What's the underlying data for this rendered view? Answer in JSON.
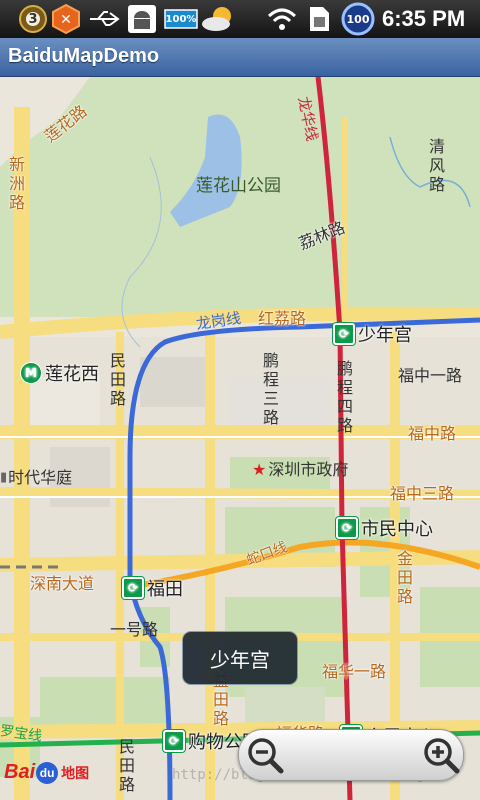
{
  "status_bar": {
    "notification_badge": "3",
    "battery_percent": "100%",
    "signal_badge": "100",
    "time": "6:35 PM",
    "icons": [
      "notification-icon",
      "hex-app-icon",
      "usb-icon",
      "android-debug-icon",
      "battery-icon",
      "weather-icon",
      "wifi-icon",
      "sim-icon",
      "data-badge-icon"
    ]
  },
  "app": {
    "title": "BaiduMapDemo"
  },
  "map": {
    "parks": [
      {
        "name": "莲花山公园"
      }
    ],
    "roads": {
      "lianhua_road": "莲花路",
      "xinzhou_road": "新洲路",
      "lichun": "龙华线",
      "longgang": "龙岗线",
      "hongli": "红荔路",
      "lilin": "荔林路",
      "qingfeng": "清风路",
      "mintian": "民田路",
      "pengcheng3": "鹏程三路",
      "pengcheng4": "鹏程四路",
      "fuzhong1": "福中一路",
      "fuzhong": "福中路",
      "fuzhong3": "福中三路",
      "shekou": "蛇口线",
      "shennan": "深南大道",
      "yihao": "一号路",
      "jintian": "金田路",
      "fuhua1": "福华一路",
      "yitian": "益田路",
      "luobao": "罗宝线",
      "fuhua": "福华路",
      "mintian2": "民田路"
    },
    "pois": {
      "city_hall": "深圳市政府",
      "shidai": "时代华庭"
    },
    "stations": {
      "shaoniangong": "少年宫",
      "lianhuaxi": "莲花西",
      "shiminzhongxin": "市民中心",
      "futian": "福田",
      "gouwugongyuan": "购物公园",
      "huizhanzhongxin": "会展中心"
    },
    "colors": {
      "metro_red": "#d0243c",
      "metro_blue": "#3b6ad8",
      "metro_green": "#0a9a48",
      "road_yellow": "#f8e08c",
      "park_green": "#c9dfb3"
    }
  },
  "popup": {
    "label": "少年宫"
  },
  "zoom": {
    "zoom_out": "zoom-out-icon",
    "zoom_in": "zoom-in-icon"
  },
  "logo": {
    "brand": "Bai",
    "paw": "du",
    "suffix": "地图"
  },
  "watermark": "http://blog.csdn.net/xiaanming"
}
